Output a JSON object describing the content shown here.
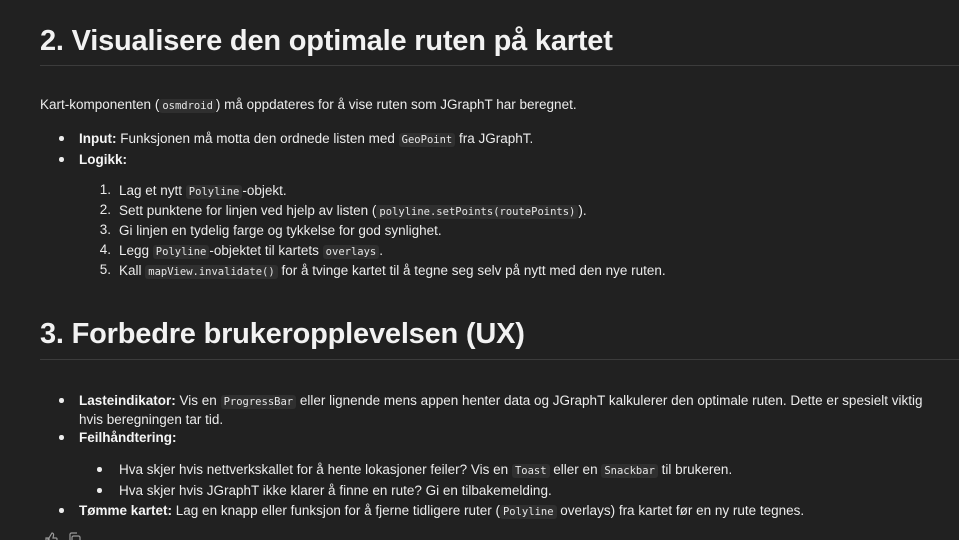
{
  "section2": {
    "heading": "2. Visualisere den optimale ruten på kartet",
    "intro_before": "Kart-komponenten (",
    "intro_code": "osmdroid",
    "intro_after": ") må oppdateres for å vise ruten som JGraphT har beregnet.",
    "input_label": "Input:",
    "input_before": " Funksjonen må motta den ordnede listen med ",
    "input_code": "GeoPoint",
    "input_after": " fra JGraphT.",
    "logic_label": "Logikk:",
    "steps": [
      {
        "num": "1.",
        "before": "Lag et nytt ",
        "code": "Polyline",
        "after": "-objekt."
      },
      {
        "num": "2.",
        "before": "Sett punktene for linjen ved hjelp av listen (",
        "code": "polyline.setPoints(routePoints)",
        "after": ")."
      },
      {
        "num": "3.",
        "text": "Gi linjen en tydelig farge og tykkelse for god synlighet."
      },
      {
        "num": "4.",
        "before": "Legg ",
        "code": "Polyline",
        "middle": "-objektet til kartets ",
        "code2": "overlays",
        "after": "."
      },
      {
        "num": "5.",
        "before": "Kall ",
        "code": "mapView.invalidate()",
        "after": " for å tvinge kartet til å tegne seg selv på nytt med den nye ruten."
      }
    ]
  },
  "section3": {
    "heading": "3. Forbedre brukeropplevelsen (UX)",
    "loading_label": "Lasteindikator:",
    "loading_before": " Vis en ",
    "loading_code": "ProgressBar",
    "loading_after": " eller lignende mens appen henter data og JGraphT kalkulerer den optimale ruten. Dette er spesielt viktig hvis beregningen tar tid.",
    "error_label": "Feilhåndtering:",
    "error_items": [
      {
        "before": "Hva skjer hvis nettverkskallet for å hente lokasjoner feiler? Vis en ",
        "code": "Toast",
        "middle": " eller en ",
        "code2": "Snackbar",
        "after": " til brukeren."
      },
      {
        "text": "Hva skjer hvis JGraphT ikke klarer å finne en rute? Gi en tilbakemelding."
      }
    ],
    "clear_label": "Tømme kartet:",
    "clear_before": " Lag en knapp eller funksjon for å fjerne tidligere ruter (",
    "clear_code": "Polyline",
    "clear_after": " overlays) fra kartet før en ny rute tegnes."
  },
  "icons": [
    "thumbs-up-icon",
    "copy-icon"
  ]
}
